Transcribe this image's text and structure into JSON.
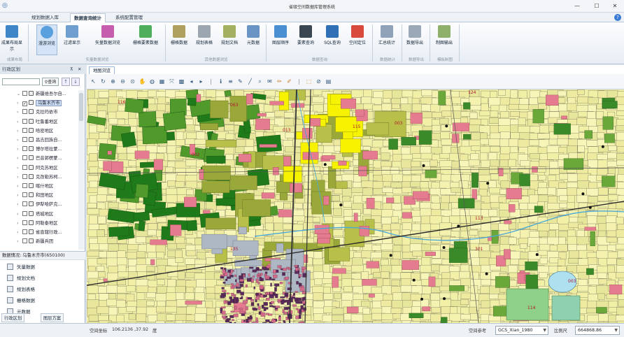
{
  "window": {
    "title": "省级空间数据库管理系统",
    "min": "—",
    "max": "☐",
    "close": "✕"
  },
  "menu_tabs": [
    "规划数据入库",
    "数据查询统计",
    "系统配置管理"
  ],
  "ribbon": {
    "buttons": [
      "成果布局显示",
      "漫游浏览",
      "过滤显示",
      "矢量数据浏览",
      "栅格要素数据",
      "栅格数据",
      "规划表格",
      "规划文档",
      "元数据",
      "图层顺序",
      "要素查询",
      "SQL查询",
      "空间定位",
      "汇总统计",
      "数据导出",
      "制图输出"
    ],
    "groups": [
      "成果布局",
      "矢量数据浏览",
      "其他数据浏览",
      "数据查询",
      "数据统计",
      "数据导出",
      "模板制图"
    ]
  },
  "left_panel": {
    "title": "行政区划",
    "pin": "⊼",
    "close": "✕",
    "query_button": "查询",
    "tree": [
      {
        "label": "新疆维吾尔自...",
        "checked": false,
        "expanded": true,
        "selected": false
      },
      {
        "label": "乌鲁木齐市",
        "checked": true,
        "expanded": false,
        "selected": true
      },
      {
        "label": "克拉玛依市",
        "checked": false,
        "expanded": false,
        "selected": false
      },
      {
        "label": "吐鲁番地区",
        "checked": false,
        "expanded": false,
        "selected": false
      },
      {
        "label": "哈密地区",
        "checked": false,
        "expanded": false,
        "selected": false
      },
      {
        "label": "昌吉回族自...",
        "checked": false,
        "expanded": false,
        "selected": false
      },
      {
        "label": "博尔塔拉蒙...",
        "checked": false,
        "expanded": false,
        "selected": false
      },
      {
        "label": "巴音郭楞蒙...",
        "checked": false,
        "expanded": false,
        "selected": false
      },
      {
        "label": "阿克苏地区",
        "checked": false,
        "expanded": false,
        "selected": false
      },
      {
        "label": "克孜勒苏柯...",
        "checked": false,
        "expanded": false,
        "selected": false
      },
      {
        "label": "喀什地区",
        "checked": false,
        "expanded": false,
        "selected": false
      },
      {
        "label": "和田地区",
        "checked": false,
        "expanded": false,
        "selected": false
      },
      {
        "label": "伊犁哈萨克...",
        "checked": false,
        "expanded": false,
        "selected": false
      },
      {
        "label": "塔城地区",
        "checked": false,
        "expanded": false,
        "selected": false
      },
      {
        "label": "阿勒泰地区",
        "checked": false,
        "expanded": false,
        "selected": false
      },
      {
        "label": "省直辖行政...",
        "checked": false,
        "expanded": false,
        "selected": false
      },
      {
        "label": "新疆兵团",
        "checked": false,
        "expanded": false,
        "selected": false
      }
    ],
    "info_label": "数据情况: 乌鲁木齐市(650100)",
    "data_items": [
      "矢量数据",
      "规划文档",
      "规划表格",
      "栅格数据",
      "元数据"
    ],
    "bottom_tabs": [
      "行政区划",
      "图层方案"
    ]
  },
  "doc_tab": "地图浏览",
  "map_labels": [
    "116",
    "002",
    "063",
    "013",
    "115",
    "003",
    "124",
    "135",
    "301",
    "113",
    "003",
    "114"
  ],
  "status": {
    "coord_label": "空间坐标",
    "coord_value": "106.2136 ,37.92",
    "coord_unit": "度",
    "srs_label": "空间参考",
    "srs_value": "GCS_Xian_1980",
    "scale_label": "比例尺",
    "scale_value": "664868.86"
  }
}
